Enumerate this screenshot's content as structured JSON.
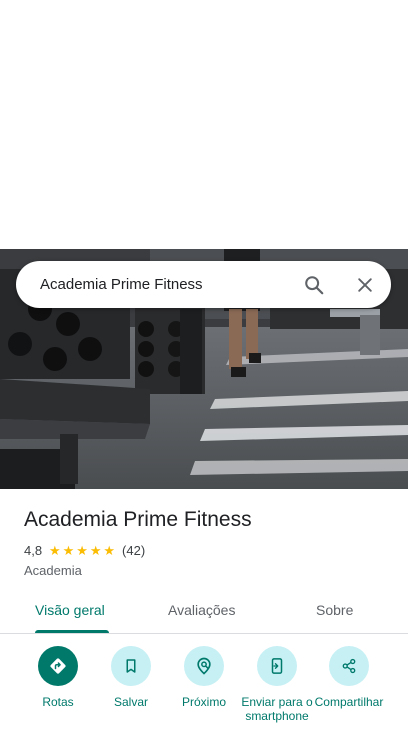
{
  "search": {
    "query": "Academia Prime Fitness",
    "search_icon": "search-icon",
    "close_icon": "close-icon"
  },
  "hero": {
    "image": "gym interior photo with dumbbell racks and treadmills"
  },
  "place": {
    "name": "Academia Prime Fitness",
    "rating": "4,8",
    "stars": 5,
    "reviews_count": "(42)",
    "category": "Academia"
  },
  "tabs": [
    {
      "label": "Visão geral",
      "active": true
    },
    {
      "label": "Avaliações",
      "active": false
    },
    {
      "label": "Sobre",
      "active": false
    }
  ],
  "actions": [
    {
      "label": "Rotas",
      "icon": "directions-icon"
    },
    {
      "label": "Salvar",
      "icon": "bookmark-icon"
    },
    {
      "label": "Próximo",
      "icon": "nearby-icon"
    },
    {
      "label": "Enviar para o smartphone",
      "icon": "send-to-phone-icon"
    },
    {
      "label": "Compartilhar",
      "icon": "share-icon"
    }
  ],
  "colors": {
    "accent": "#00796b",
    "action_bg": "#c6f0f4",
    "star": "#fbbc04"
  }
}
